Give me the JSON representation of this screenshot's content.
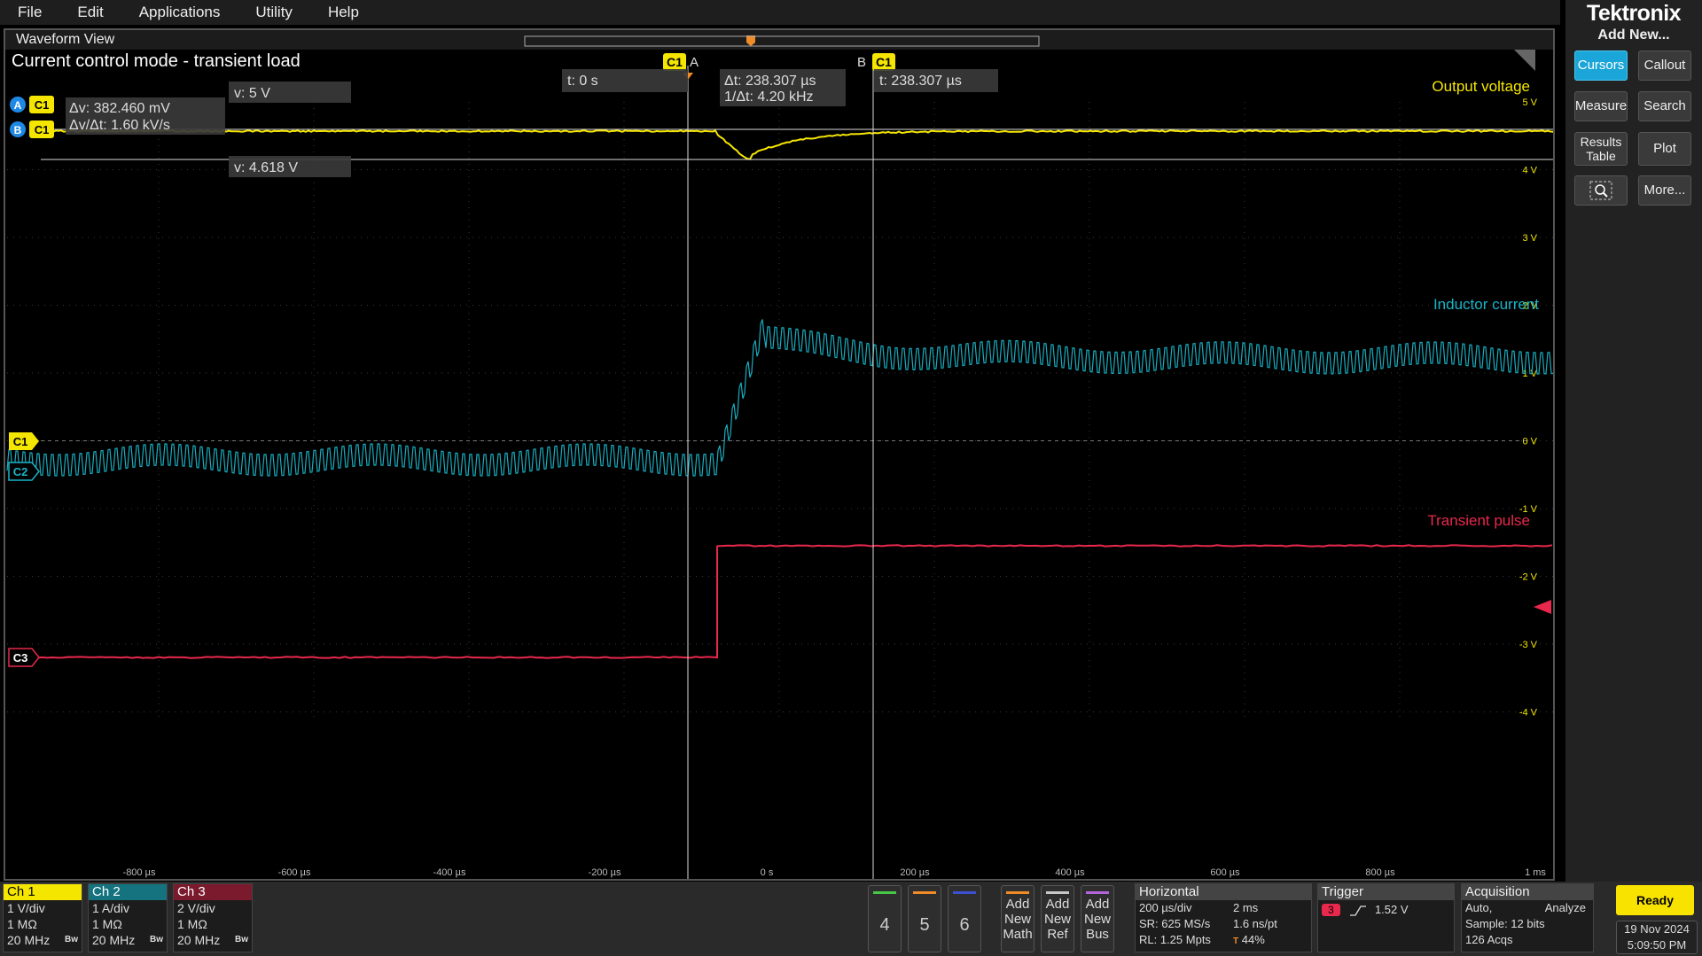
{
  "menu": [
    "File",
    "Edit",
    "Applications",
    "Utility",
    "Help"
  ],
  "brand": "Tektronix",
  "right_panel": {
    "add_new": "Add New...",
    "buttons": {
      "cursors": "Cursors",
      "callout": "Callout",
      "measure": "Measure",
      "search": "Search",
      "results_table_1": "Results",
      "results_table_2": "Table",
      "plot": "Plot",
      "more": "More..."
    }
  },
  "waveform_view": {
    "title": "Waveform View",
    "plot_title": "Current control mode - transient load",
    "trace_labels": {
      "ch1": "Output voltage",
      "ch2": "Inductor current",
      "ch3": "Transient pulse"
    },
    "y_ticks": [
      "5 V",
      "4 V",
      "3 V",
      "2 V",
      "1 V",
      "0 V",
      "-1 V",
      "-2 V",
      "-3 V",
      "-4 V"
    ],
    "x_ticks": [
      "-800 µs",
      "-600 µs",
      "-400 µs",
      "-200 µs",
      "0 s",
      "200 µs",
      "400 µs",
      "600 µs",
      "800 µs",
      "1 ms"
    ],
    "cursor_a_label": "A",
    "cursor_b_label": "B",
    "ch1_tag": "C1",
    "ch2_tag": "C2",
    "ch3_tag": "C3",
    "cursor_readouts": {
      "t_a": "t: 0 s",
      "t_b": "t: 238.307 µs",
      "delta_t": "Δt: 238.307 µs",
      "inv_delta_t": "1/Δt: 4.20 kHz",
      "v_a": "v: 5 V",
      "v_b": "v: 4.618 V",
      "delta_v": "Δv: 382.460 mV",
      "dv_dt": "Δv/Δt: 1.60 kV/s"
    }
  },
  "channels": [
    {
      "name": "Ch 1",
      "scale": "1 V/div",
      "impedance": "1 MΩ",
      "bw": "20 MHz",
      "color": "#f5e600"
    },
    {
      "name": "Ch 2",
      "scale": "1 A/div",
      "impedance": "1 MΩ",
      "bw": "20 MHz",
      "color": "#19b5c8"
    },
    {
      "name": "Ch 3",
      "scale": "2 V/div",
      "impedance": "1 MΩ",
      "bw": "20 MHz",
      "color": "#e8284c"
    }
  ],
  "bw_mark": "Bw",
  "num_buttons": [
    "4",
    "5",
    "6"
  ],
  "add_buttons": [
    {
      "l1": "Add",
      "l2": "New",
      "l3": "Math"
    },
    {
      "l1": "Add",
      "l2": "New",
      "l3": "Ref"
    },
    {
      "l1": "Add",
      "l2": "New",
      "l3": "Bus"
    }
  ],
  "horizontal": {
    "title": "Horizontal",
    "scale": "200 µs/div",
    "record_time": "2 ms",
    "sample_rate": "SR: 625 MS/s",
    "per_point": "1.6 ns/pt",
    "record_length": "RL: 1.25 Mpts",
    "position": "44%"
  },
  "trigger": {
    "title": "Trigger",
    "source": "3",
    "level": "1.52 V"
  },
  "acquisition": {
    "title": "Acquisition",
    "mode": "Auto,",
    "analyze": "Analyze",
    "sample": "Sample: 12 bits",
    "acqs": "126 Acqs"
  },
  "status": "Ready",
  "date": "19 Nov 2024",
  "time": "5:09:50 PM",
  "colors": {
    "ch1": "#f5e600",
    "ch2": "#19b5c8",
    "ch3": "#e8284c",
    "accent": "#1aa6d8"
  }
}
